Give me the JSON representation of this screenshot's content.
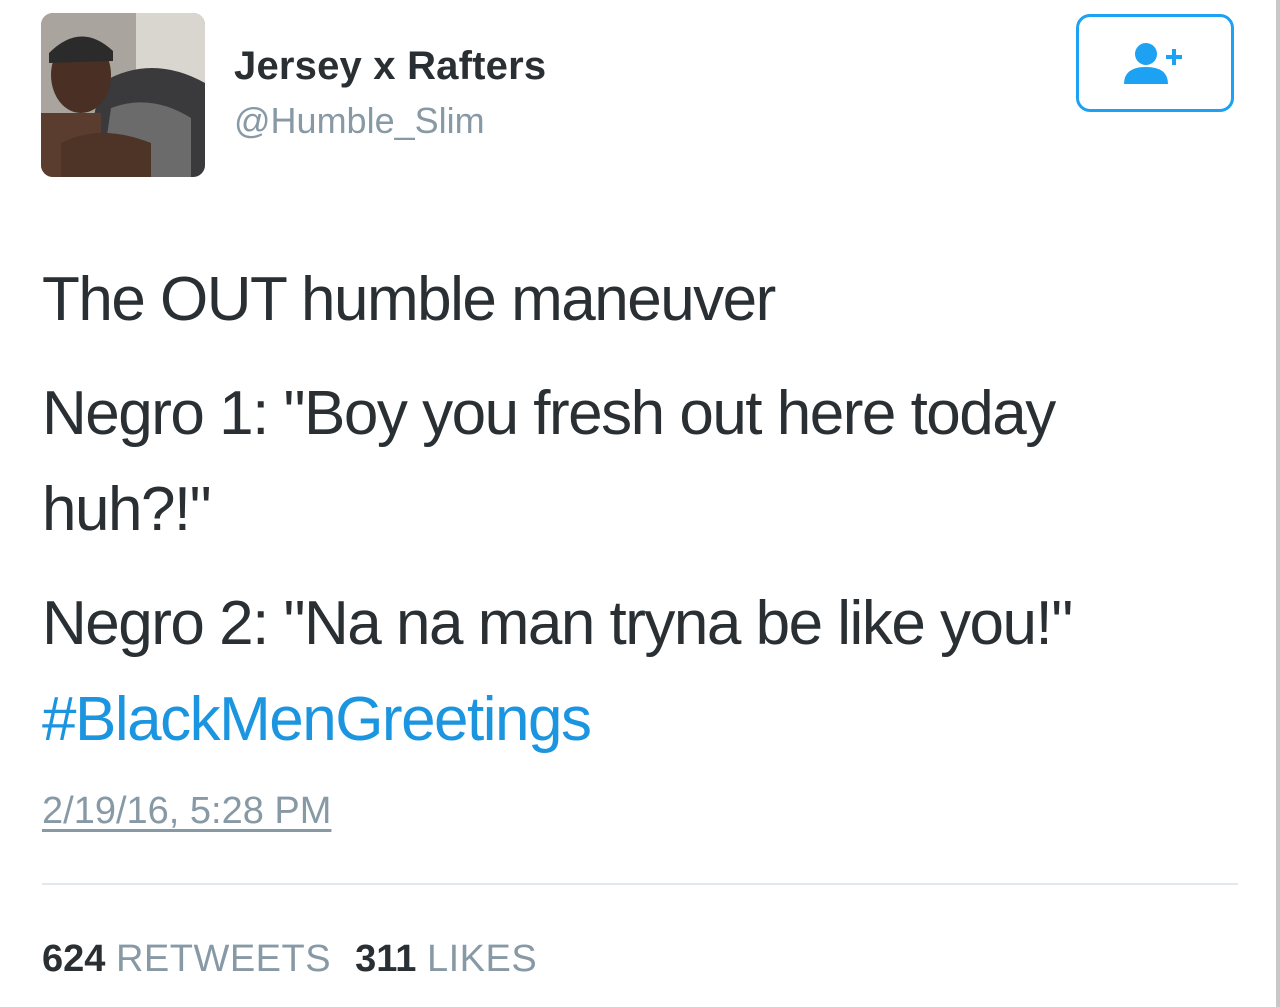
{
  "user": {
    "display_name": "Jersey x Rafters",
    "handle": "@Humble_Slim",
    "avatar": "profile-photo"
  },
  "follow_button": {
    "icon": "add-user-icon",
    "color": "#1da1f2"
  },
  "tweet": {
    "lines": [
      "The OUT humble maneuver",
      "Negro 1: \"Boy you fresh out here today",
      "huh?!\"",
      "Negro 2: \"Na na man tryna be like you!\""
    ],
    "hashtag": "#BlackMenGreetings",
    "timestamp": "2/19/16, 5:28 PM"
  },
  "stats": {
    "retweets_count": "624",
    "retweets_label": "RETWEETS",
    "likes_count": "311",
    "likes_label": "LIKES"
  },
  "colors": {
    "text": "#292f33",
    "secondary": "#8899a6",
    "link": "#1b95e0",
    "divider": "#e1e8ed"
  }
}
